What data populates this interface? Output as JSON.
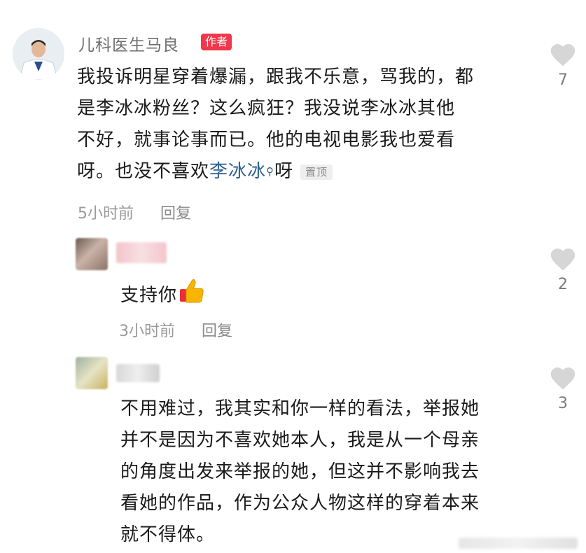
{
  "comments": [
    {
      "author": "儿科医生马良",
      "badge": "作者",
      "text_parts": [
        "我投诉明星穿着爆漏，跟我不乐意，骂我的，都",
        "是李冰冰粉丝？这么疯狂？我没说李冰冰其他",
        "不好，就事论事而已。他的电视电影我也爱看",
        "呀。也没不喜欢",
        "李冰冰",
        "呀"
      ],
      "pin_label": "置顶",
      "time": "5小时前",
      "reply_label": "回复",
      "likes": "7",
      "icons": {
        "avatar": "doctor-avatar",
        "search": "search-icon",
        "like": "heart-icon"
      }
    },
    {
      "author": "",
      "text": "支持你",
      "emoji": "thumbs-up-icon",
      "time": "3小时前",
      "reply_label": "回复",
      "likes": "2"
    },
    {
      "author": "",
      "text_lines": [
        "不用难过，我其实和你一样的看法，举报她",
        "并不是因为不喜欢她本人，我是从一个母亲",
        "的角度出发来举报的她，但这并不影响我去",
        "看她的作品，作为公众人物这样的穿着本来",
        "就不得体。"
      ],
      "likes": "3"
    }
  ],
  "colors": {
    "badge": "#f0374b",
    "link": "#2c5f8d",
    "heart": "#d6d6d6"
  }
}
